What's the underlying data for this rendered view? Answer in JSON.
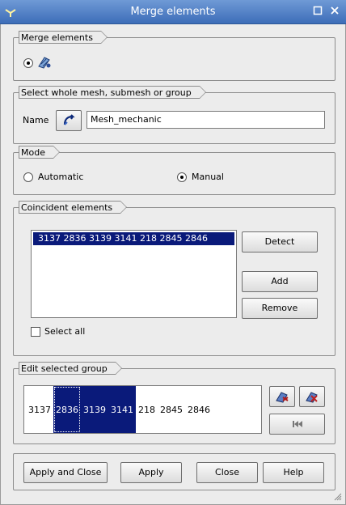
{
  "window": {
    "title": "Merge elements"
  },
  "groups": {
    "merge_elements": {
      "title": "Merge elements"
    },
    "select_mesh": {
      "title": "Select whole mesh, submesh or group",
      "name_label": "Name",
      "name_value": "Mesh_mechanic"
    },
    "mode": {
      "title": "Mode",
      "automatic_label": "Automatic",
      "manual_label": "Manual",
      "selected": "Manual"
    },
    "coincident": {
      "title": "Coincident elements",
      "list_items": [
        "3137 2836 3139 3141 218 2845 2846"
      ],
      "detect_label": "Detect",
      "add_label": "Add",
      "remove_label": "Remove",
      "select_all_label": "Select all"
    },
    "edit_group": {
      "title": "Edit selected group",
      "items": [
        "3137",
        "2836",
        "3139",
        "3141",
        "218",
        "2845",
        "2846"
      ],
      "selected_items": [
        "2836",
        "3139",
        "3141"
      ]
    }
  },
  "footer": {
    "apply_close_label": "Apply and Close",
    "apply_label": "Apply",
    "close_label": "Close",
    "help_label": "Help"
  }
}
